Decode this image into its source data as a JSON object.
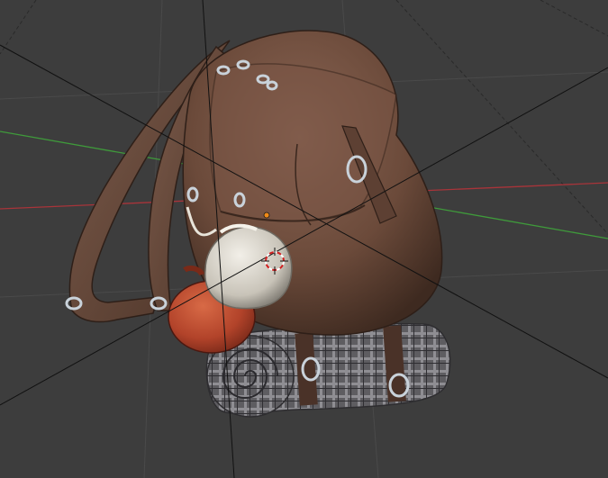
{
  "viewport": {
    "background": "#3d3d3d",
    "grid_color": "#4a4a4a",
    "x_axis_color": "#a8343a",
    "y_axis_color": "#3f9a3b",
    "dashed_guides": true,
    "wire_line_color": "#111111"
  },
  "scene": {
    "objects": [
      {
        "name": "backpack",
        "material_color": "#6b4a3a"
      },
      {
        "name": "bedroll",
        "material_color": "#6b6a6d"
      },
      {
        "name": "cloth-pouch",
        "material_color": "#d9d5cc"
      },
      {
        "name": "water-gourd",
        "material_color": "#b84a2e"
      }
    ],
    "rings_color": "#c9d2da",
    "origin_dot_color": "#f08a18",
    "cursor_3d": {
      "ring_colors": [
        "#ffffff",
        "#d02020"
      ]
    }
  }
}
